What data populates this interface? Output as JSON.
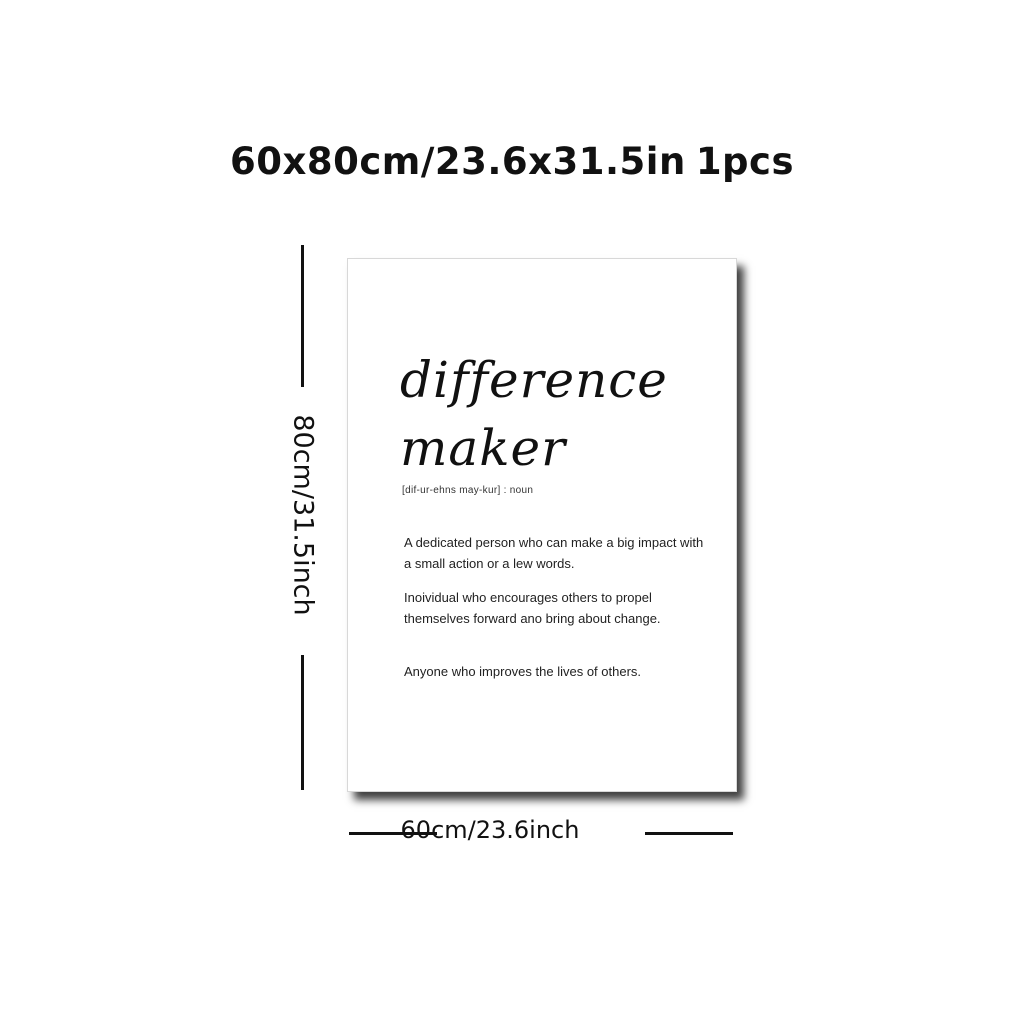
{
  "headline": {
    "size_text": "60x80cm/23.6x31.5in",
    "qty_text": "1pcs"
  },
  "dimensions": {
    "height_label": "80cm/31.5inch",
    "width_label": "60cm/23.6inch"
  },
  "poster": {
    "title_line1": "difference",
    "title_line2": "maker",
    "pronunciation": "[dif-ur-ehns may-kur] : noun",
    "definitions": [
      "A dedicated person who can make a big impact with a small action or a lew words.",
      "Inoividual who encourages others to propel themselves forward ano bring about change.",
      "Anyone who improves the lives of others."
    ]
  }
}
